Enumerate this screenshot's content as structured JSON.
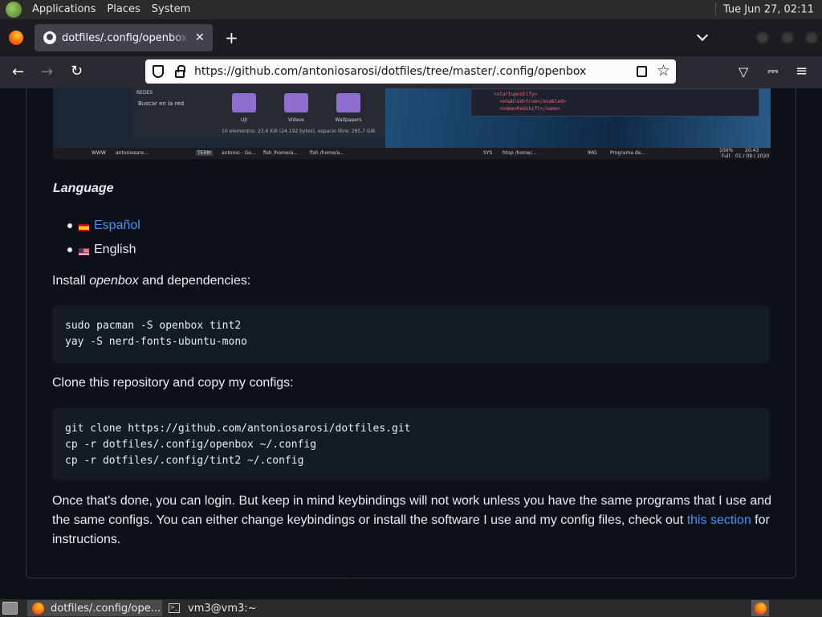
{
  "top_panel": {
    "menus": [
      "Applications",
      "Places",
      "System"
    ],
    "clock": "Tue Jun 27, 02:11"
  },
  "browser": {
    "tab_title": "dotfiles/.config/openbox at master",
    "tab_close": "✕",
    "new_tab": "+",
    "url": "https://github.com/antoniosarosi/dotfiles/tree/master/.config/openbox"
  },
  "screenshot": {
    "redes": "REDES",
    "buscar": "Buscar en la red",
    "folders": [
      "UJI",
      "Vídeos",
      "Wallpapers"
    ],
    "status": "10 elementos: 23,6 KiB (24.192 bytes), espacio libre: 285,7 GiB",
    "code_lines": [
      "<startupnotify>",
      "  <enabled>true</enabled>",
      "  <name>Redshift</name>"
    ],
    "taskbar": {
      "www": "WWW",
      "term": "TERM",
      "sys": "SYS",
      "img": "IMG",
      "t1": "antoniosaro...",
      "t2": "antonio - Ge...",
      "t3": "fish /home/a...",
      "t4": "fish /home/a...",
      "t5": "htop /home/...",
      "t6": "Programa de...",
      "battery": "100%",
      "battery_state": "Full",
      "time": "20:43",
      "date": "01 / 09 / 2020"
    }
  },
  "readme": {
    "language_heading": "Language",
    "languages": [
      {
        "label": "Español",
        "link": true
      },
      {
        "label": "English",
        "link": false
      }
    ],
    "install_pre": "Install ",
    "install_em": "openbox",
    "install_post": " and dependencies:",
    "code1": "sudo pacman -S openbox tint2\nyay -S nerd-fonts-ubuntu-mono",
    "clone_text": "Clone this repository and copy my configs:",
    "code2": "git clone https://github.com/antoniosarosi/dotfiles.git\ncp -r dotfiles/.config/openbox ~/.config\ncp -r dotfiles/.config/tint2 ~/.config",
    "final_pre": "Once that's done, you can login. But keep in mind keybindings will not work unless you have the same programs that I use and the same configs. You can either change keybindings or install the software I use and my config files, check out ",
    "final_link": "this section",
    "final_post": " for instructions."
  },
  "bottom_panel": {
    "tasks": [
      "dotfiles/.config/ope...",
      "vm3@vm3:~"
    ]
  }
}
